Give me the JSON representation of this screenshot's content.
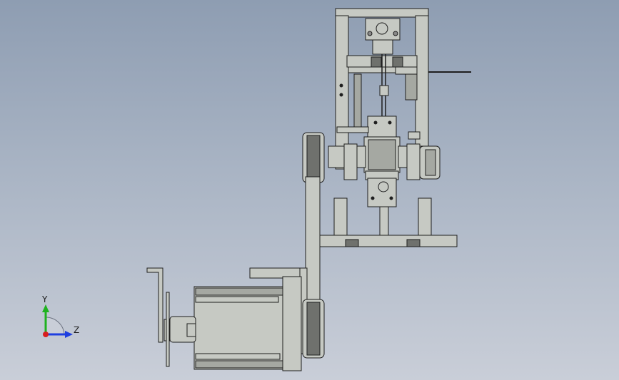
{
  "viewport": {
    "background_top": "#8e9db2",
    "background_bottom": "#c9ced8"
  },
  "model": {
    "part_fill": "#c6c9c3",
    "part_stroke": "#1e1e1e",
    "dark_fill": "#6f716d",
    "shade_fill": "#a5a8a2"
  },
  "triad": {
    "y_axis_label": "Y",
    "z_axis_label": "Z",
    "y_color": "#1fb21f",
    "z_color": "#1e3fe0",
    "x_color": "#d81f1f"
  }
}
